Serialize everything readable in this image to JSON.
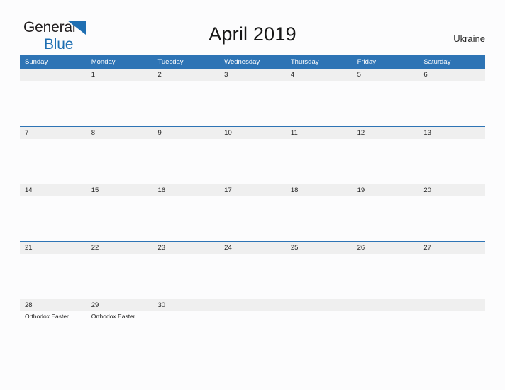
{
  "branding": {
    "name_part1": "General",
    "name_part2": "Blue",
    "flag_icon": "blue-flag-triangle-icon",
    "accent_color": "#1f6fb2",
    "dark_color": "#231f20"
  },
  "header": {
    "title": "April 2019",
    "region": "Ukraine"
  },
  "colors": {
    "header_blue": "#2e74b5",
    "date_strip_gray": "#efefef",
    "page_background": "#fcfcfd",
    "text_dark": "#262626"
  },
  "calendar": {
    "weekday_headers": [
      "Sunday",
      "Monday",
      "Tuesday",
      "Wednesday",
      "Thursday",
      "Friday",
      "Saturday"
    ],
    "weeks": [
      {
        "days": [
          {
            "date": "",
            "events": []
          },
          {
            "date": "1",
            "events": []
          },
          {
            "date": "2",
            "events": []
          },
          {
            "date": "3",
            "events": []
          },
          {
            "date": "4",
            "events": []
          },
          {
            "date": "5",
            "events": []
          },
          {
            "date": "6",
            "events": []
          }
        ]
      },
      {
        "days": [
          {
            "date": "7",
            "events": []
          },
          {
            "date": "8",
            "events": []
          },
          {
            "date": "9",
            "events": []
          },
          {
            "date": "10",
            "events": []
          },
          {
            "date": "11",
            "events": []
          },
          {
            "date": "12",
            "events": []
          },
          {
            "date": "13",
            "events": []
          }
        ]
      },
      {
        "days": [
          {
            "date": "14",
            "events": []
          },
          {
            "date": "15",
            "events": []
          },
          {
            "date": "16",
            "events": []
          },
          {
            "date": "17",
            "events": []
          },
          {
            "date": "18",
            "events": []
          },
          {
            "date": "19",
            "events": []
          },
          {
            "date": "20",
            "events": []
          }
        ]
      },
      {
        "days": [
          {
            "date": "21",
            "events": []
          },
          {
            "date": "22",
            "events": []
          },
          {
            "date": "23",
            "events": []
          },
          {
            "date": "24",
            "events": []
          },
          {
            "date": "25",
            "events": []
          },
          {
            "date": "26",
            "events": []
          },
          {
            "date": "27",
            "events": []
          }
        ]
      },
      {
        "days": [
          {
            "date": "28",
            "events": [
              "Orthodox Easter"
            ]
          },
          {
            "date": "29",
            "events": [
              "Orthodox Easter"
            ]
          },
          {
            "date": "30",
            "events": []
          },
          {
            "date": "",
            "events": []
          },
          {
            "date": "",
            "events": []
          },
          {
            "date": "",
            "events": []
          },
          {
            "date": "",
            "events": []
          }
        ]
      }
    ]
  }
}
